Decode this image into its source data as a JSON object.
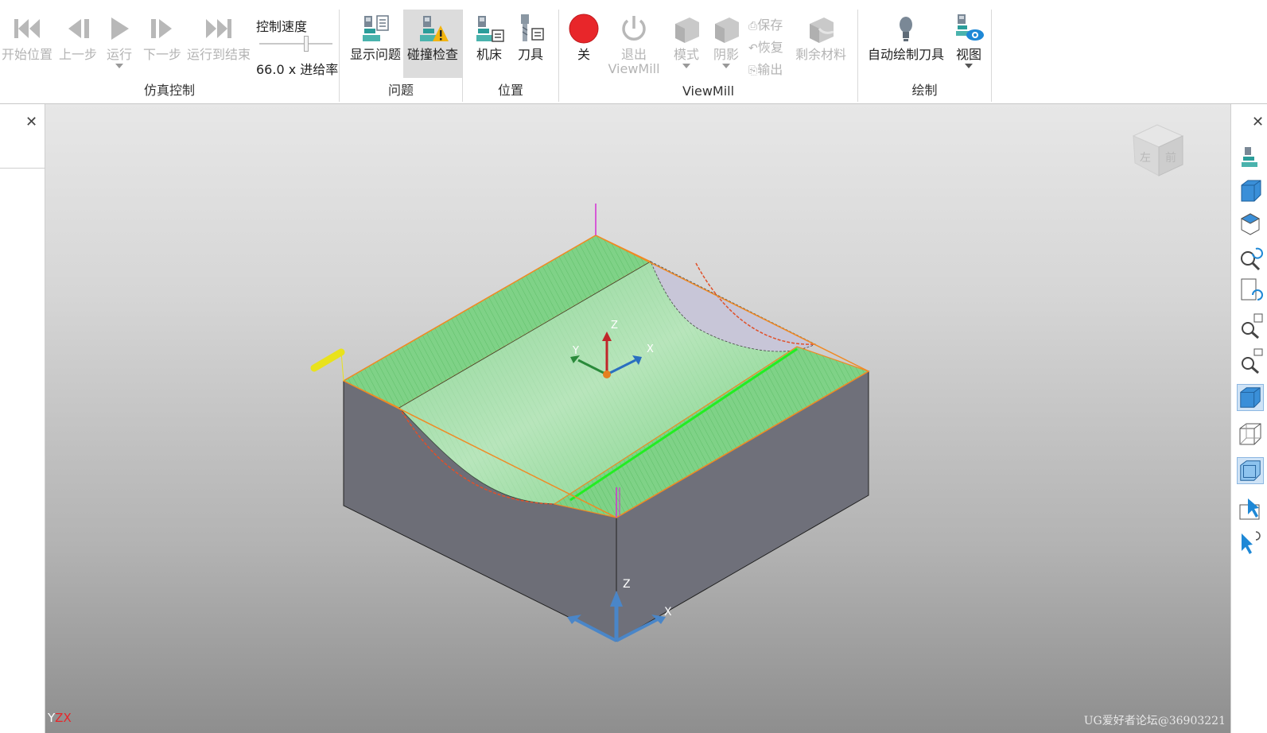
{
  "ribbon": {
    "sim_control": {
      "group_label": "仿真控制",
      "start": "开始位置",
      "prev": "上一步",
      "run": "运行",
      "next": "下一步",
      "run_to_end": "运行到结束",
      "speed_label": "控制速度",
      "speed_value": "66.0 x 进给率"
    },
    "problems": {
      "group_label": "问题",
      "show_problems": "显示问题",
      "collision_check": "碰撞检查"
    },
    "position": {
      "group_label": "位置",
      "machine": "机床",
      "tool": "刀具"
    },
    "viewmill": {
      "group_label": "ViewMill",
      "off": "关",
      "exit": "退出",
      "exit2": "ViewMill",
      "mode": "模式",
      "shade": "阴影",
      "save": "保存",
      "restore": "恢复",
      "output": "输出",
      "remaining": "剩余材料"
    },
    "draw": {
      "group_label": "绘制",
      "auto_draw": "自动绘制刀具",
      "view": "视图"
    }
  },
  "viewport": {
    "axis_labels": {
      "z": "Z",
      "x": "X",
      "y": "Y"
    },
    "world_axis": {
      "z": "Z",
      "x": "X"
    },
    "viewcube": {
      "left": "左",
      "front": "前"
    },
    "corner_triad": {
      "y": "Y",
      "z": "Z",
      "x": "X"
    },
    "watermark": "UG爱好者论坛@36903221"
  },
  "colors": {
    "accent_red": "#e8262a",
    "toolpath_green": "#53d653",
    "stock_gray": "#6d6e77",
    "axis_blue": "#4a86c8",
    "selected_blue": "#cfe3f6"
  }
}
